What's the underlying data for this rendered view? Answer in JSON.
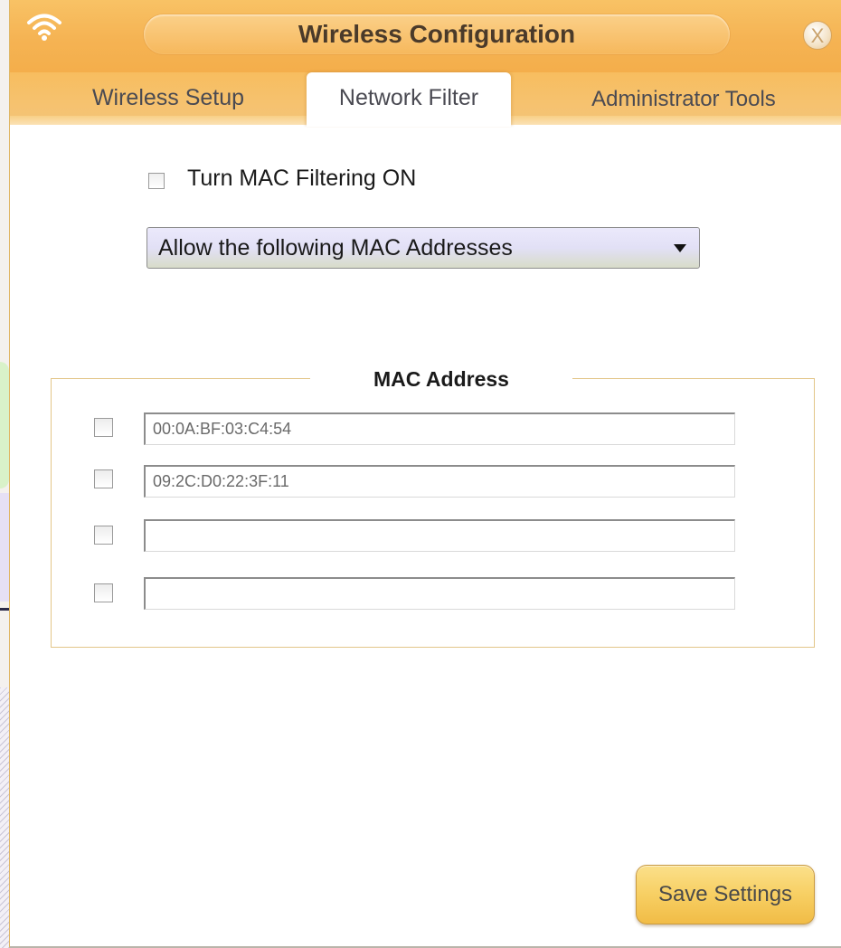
{
  "window": {
    "title": "Wireless Configuration",
    "close_glyph": "X"
  },
  "tabs": [
    {
      "label": "Wireless Setup",
      "active": false
    },
    {
      "label": "Network Filter",
      "active": true
    },
    {
      "label": "Administrator Tools",
      "active": false
    }
  ],
  "mac_filter": {
    "toggle_label": "Turn MAC Filtering ON",
    "toggle_checked": false,
    "mode_selected": "Allow the following MAC Addresses"
  },
  "mac_list": {
    "legend": "MAC Address",
    "rows": [
      {
        "checked": false,
        "value": "00:0A:BF:03:C4:54"
      },
      {
        "checked": false,
        "value": "09:2C:D0:22:3F:11"
      },
      {
        "checked": false,
        "value": ""
      },
      {
        "checked": false,
        "value": ""
      }
    ]
  },
  "actions": {
    "save_label": "Save Settings"
  },
  "colors": {
    "titlebar": "#f5b353",
    "accent_border": "#e3c689",
    "button": "#f7cf63"
  },
  "icons": {
    "app": "wifi-icon",
    "close": "close-icon",
    "dropdown": "dropdown-arrow-icon"
  }
}
